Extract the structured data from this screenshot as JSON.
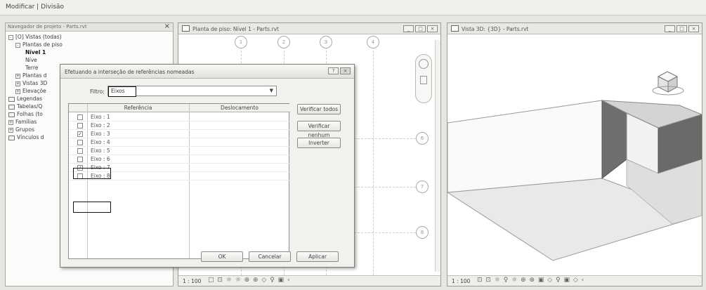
{
  "ribbon": {
    "title": "Modificar | Divisão"
  },
  "browser": {
    "title": "Navegador de projeto - Parts.rvt",
    "close": "×",
    "items": [
      {
        "label": "[O] Vistas (todas)",
        "toggle": "-",
        "bold": false
      },
      {
        "label": "Plantas de piso",
        "toggle": "-",
        "bold": false
      },
      {
        "label": "Nível 1",
        "toggle": "",
        "bold": true
      },
      {
        "label": "Níve",
        "toggle": "",
        "bold": false
      },
      {
        "label": "Terre",
        "toggle": "",
        "bold": false
      },
      {
        "label": "Plantas d",
        "toggle": "+",
        "bold": false
      },
      {
        "label": "Vistas 3D",
        "toggle": "+",
        "bold": false
      },
      {
        "label": "Elevaçõe",
        "toggle": "+",
        "bold": false
      },
      {
        "label": "Legendas",
        "toggle": "",
        "bold": false
      },
      {
        "label": "Tabelas/Q",
        "toggle": "",
        "bold": false
      },
      {
        "label": "Folhas (to",
        "toggle": "",
        "bold": false
      },
      {
        "label": "Famílias",
        "toggle": "+",
        "bold": false
      },
      {
        "label": "Grupos",
        "toggle": "+",
        "bold": false
      },
      {
        "label": "Vínculos d",
        "toggle": "",
        "bold": false
      }
    ]
  },
  "plan_window": {
    "title": "Planta de piso: Nível 1 - Parts.rvt",
    "scale": "1 : 100",
    "status_icons": "□ ⊡ ☼ ☼ ⊕ ⊕ ◇ ♀ ▣ ‹",
    "grid_bubbles": [
      "1",
      "2",
      "3",
      "4",
      "6",
      "7",
      "8"
    ]
  },
  "view3d_window": {
    "title": "Vista 3D: {3D} - Parts.rvt",
    "scale": "1 : 100",
    "status_icons": "⊡ ⊡ ☼ ♀ ☼ ⊕ ⊕ ▣ ◇ ♀ ▣ ◇ ‹"
  },
  "dialog": {
    "title": "Efetuando a interseção de referências nomeadas",
    "filter_label": "Filtro:",
    "filter_value": "Eixos",
    "columns": [
      "Referência",
      "Deslocamento"
    ],
    "rows": [
      {
        "ref": "Eixo : 1",
        "checked": false
      },
      {
        "ref": "Eixo : 2",
        "checked": false
      },
      {
        "ref": "Eixo : 3",
        "checked": true
      },
      {
        "ref": "Eixo : 4",
        "checked": false
      },
      {
        "ref": "Eixo : 5",
        "checked": false
      },
      {
        "ref": "Eixo : 6",
        "checked": false
      },
      {
        "ref": "Eixo : 7",
        "checked": true
      },
      {
        "ref": "Eixo : 8",
        "checked": false
      }
    ],
    "buttons": {
      "check_all": "Verificar todos",
      "check_none": "Verificar nenhum",
      "invert": "Inverter",
      "ok": "OK",
      "cancel": "Cancelar",
      "apply": "Aplicar"
    }
  }
}
